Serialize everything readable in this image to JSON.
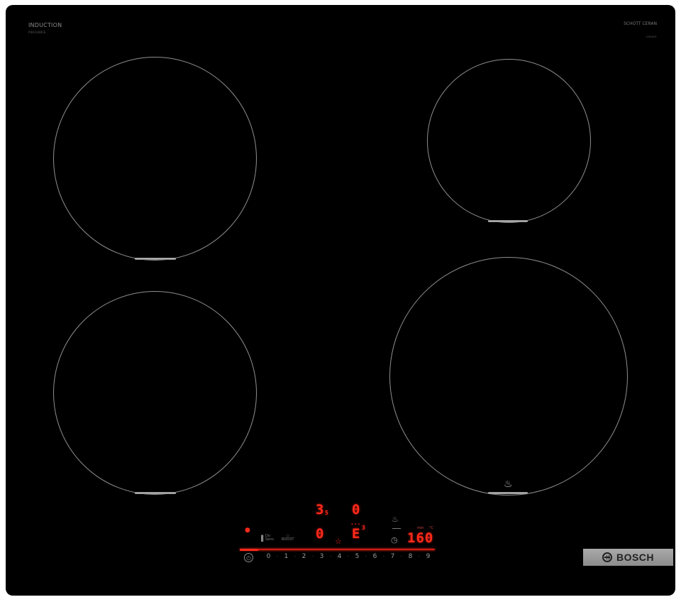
{
  "brand": {
    "induction_label": "INDUCTION",
    "model_label": "PIE631BB1E",
    "glass_brand": "SCHOTT CERAN",
    "glass_sub": "CERAN®",
    "logo_text": "BOSCH"
  },
  "zones": [
    {
      "id": "front-left",
      "name": "zone-front-left"
    },
    {
      "id": "rear-right",
      "name": "zone-rear-right"
    },
    {
      "id": "rear-left",
      "name": "zone-rear-left"
    },
    {
      "id": "front-right",
      "name": "zone-front-right"
    }
  ],
  "displays": {
    "zone1_level": "3",
    "zone1_sub": "5",
    "zone2_level": "0",
    "zone3_level": "0",
    "zone4_level": "E",
    "zone4_sub": "3",
    "timer_value": "160",
    "zone4_top": "···"
  },
  "slider": {
    "levels": [
      "0",
      "1",
      "2",
      "3",
      "4",
      "5",
      "6",
      "7",
      "8",
      "9"
    ]
  },
  "labels": {
    "sensor_1": "Do\nSens",
    "sensor_2": "○\nBOOST",
    "min_label": "min",
    "degree_label": "°C"
  },
  "colors": {
    "display_red": "#ff2a1a",
    "glass_black": "#000000",
    "zone_outline": "#8f8f8f"
  }
}
